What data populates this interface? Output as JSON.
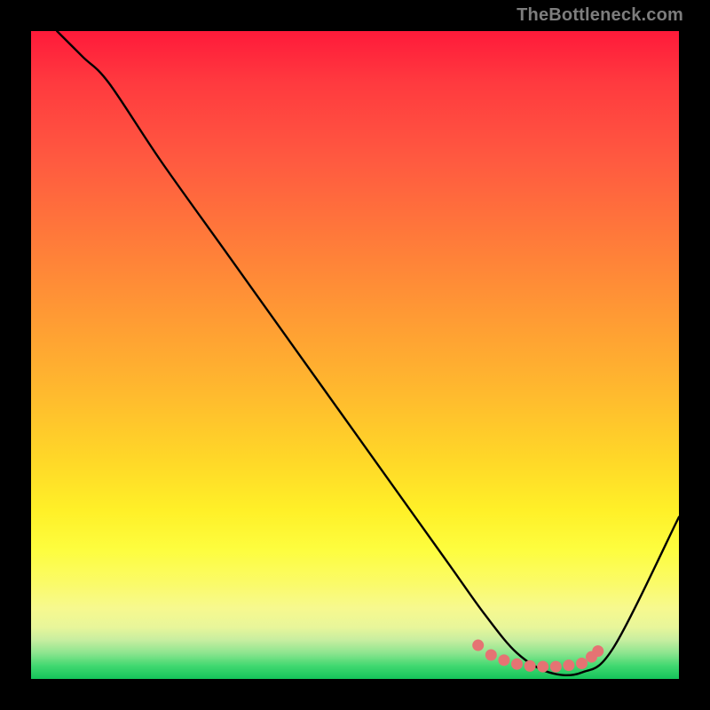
{
  "watermark": "TheBottleneck.com",
  "chart_data": {
    "type": "line",
    "title": "",
    "xlabel": "",
    "ylabel": "",
    "xlim": [
      0,
      100
    ],
    "ylim": [
      0,
      100
    ],
    "background_gradient": {
      "top": "#ff1a3a",
      "mid_upper": "#ff9a34",
      "mid_lower": "#fff028",
      "bottom": "#14c45a"
    },
    "series": [
      {
        "name": "bottleneck-curve",
        "color": "#000000",
        "x": [
          4,
          8,
          12,
          20,
          30,
          40,
          50,
          60,
          65,
          70,
          75,
          80,
          85,
          90,
          100
        ],
        "y": [
          100,
          96,
          92,
          80,
          66,
          52,
          38,
          24,
          17,
          10,
          4,
          1,
          1,
          5,
          25
        ]
      }
    ],
    "markers": {
      "name": "highlight-band",
      "color": "#e57373",
      "points": [
        {
          "x": 69,
          "y": 5.2
        },
        {
          "x": 71,
          "y": 3.7
        },
        {
          "x": 73,
          "y": 2.9
        },
        {
          "x": 75,
          "y": 2.3
        },
        {
          "x": 77,
          "y": 2.0
        },
        {
          "x": 79,
          "y": 1.9
        },
        {
          "x": 81,
          "y": 1.9
        },
        {
          "x": 83,
          "y": 2.1
        },
        {
          "x": 85,
          "y": 2.4
        },
        {
          "x": 86.5,
          "y": 3.4
        },
        {
          "x": 87.5,
          "y": 4.3
        }
      ]
    }
  }
}
